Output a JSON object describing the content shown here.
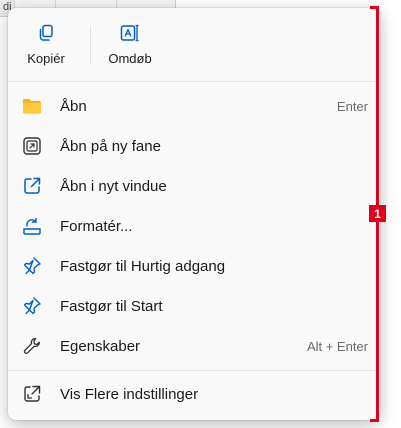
{
  "background": {
    "fragment_char": "di"
  },
  "menu": {
    "quick_actions": [
      {
        "label": "Kopiér",
        "icon": "copy-icon"
      },
      {
        "label": "Omdøb",
        "icon": "rename-icon"
      }
    ],
    "items": [
      {
        "label": "Åbn",
        "shortcut": "Enter",
        "icon": "folder-icon"
      },
      {
        "label": "Åbn på ny fane",
        "icon": "new-tab-icon"
      },
      {
        "label": "Åbn i nyt vindue",
        "icon": "open-new-window-icon"
      },
      {
        "label": "Formatér...",
        "icon": "format-drive-icon"
      },
      {
        "label": "Fastgør til Hurtig adgang",
        "icon": "pin-icon"
      },
      {
        "label": "Fastgør til Start",
        "icon": "pin-icon"
      },
      {
        "label": "Egenskaber",
        "shortcut": "Alt + Enter",
        "icon": "wrench-icon"
      },
      {
        "label": "Vis Flere indstillinger",
        "icon": "show-more-icon"
      }
    ]
  },
  "callout": {
    "number": "1",
    "color": "#e0001b"
  },
  "colors": {
    "accent": "#005fb8",
    "folder": "#f0b429"
  }
}
